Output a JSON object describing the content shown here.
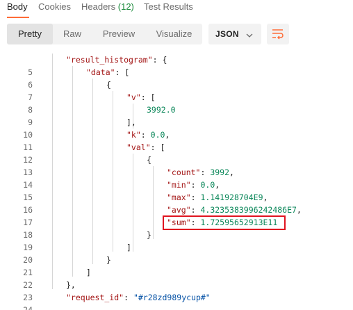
{
  "tabs": {
    "body": "Body",
    "cookies": "Cookies",
    "headers": "Headers",
    "headers_count": "(12)",
    "test_results": "Test Results"
  },
  "toolbar": {
    "pretty": "Pretty",
    "raw": "Raw",
    "preview": "Preview",
    "visualize": "Visualize",
    "format": "JSON"
  },
  "code": {
    "lines": [
      {
        "n": "5"
      },
      {
        "n": "6"
      },
      {
        "n": "7"
      },
      {
        "n": "8"
      },
      {
        "n": "9"
      },
      {
        "n": "10"
      },
      {
        "n": "11"
      },
      {
        "n": "12"
      },
      {
        "n": "13"
      },
      {
        "n": "14"
      },
      {
        "n": "15"
      },
      {
        "n": "16"
      },
      {
        "n": "17"
      },
      {
        "n": "18"
      },
      {
        "n": "19"
      },
      {
        "n": "20"
      },
      {
        "n": "21"
      },
      {
        "n": "22"
      },
      {
        "n": "23"
      },
      {
        "n": "24"
      }
    ],
    "k_result_histogram": "\"result_histogram\"",
    "k_data": "\"data\"",
    "k_v": "\"v\"",
    "v_value": "3992.0",
    "k_k": "\"k\"",
    "k_value": "0.0",
    "k_val": "\"val\"",
    "k_count": "\"count\"",
    "count_value": "3992",
    "k_min": "\"min\"",
    "min_value": "0.0",
    "k_max": "\"max\"",
    "max_value": "1.141928704E9",
    "k_avg": "\"avg\"",
    "avg_value": "4.3235383996242486E7",
    "k_sum": "\"sum\"",
    "sum_value": "1.72595652913E11",
    "k_request_id": "\"request_id\"",
    "request_id_value": "\"#r28zd989ycup#\""
  },
  "colors": {
    "accent": "#ff6c37",
    "highlight_box": "#e0131f",
    "key": "#a31515",
    "number": "#098658",
    "string": "#0451a5"
  }
}
